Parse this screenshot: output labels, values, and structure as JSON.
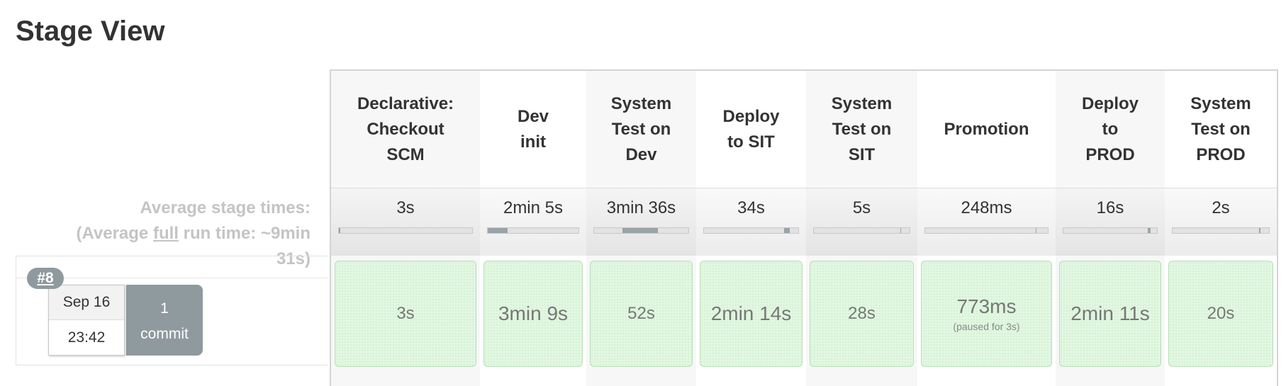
{
  "page": {
    "title": "Stage View"
  },
  "summary": {
    "avg_line1": "Average stage times:",
    "avg_line2_prefix": "(Average ",
    "avg_line2_link": "full",
    "avg_line2_suffix": " run time: ~9min",
    "avg_line3": "31s)"
  },
  "run": {
    "number": "#8",
    "date": "Sep 16",
    "time": "23:42",
    "commit_count": "1",
    "commit_label": "commit"
  },
  "stages": [
    {
      "name_lines": [
        "Declarative:",
        "Checkout",
        "SCM"
      ],
      "avg": "3s",
      "avg_fraction": 0.005,
      "duration": "3s",
      "note": ""
    },
    {
      "name_lines": [
        "Dev",
        "init"
      ],
      "avg": "2min 5s",
      "avg_fraction": 0.22,
      "duration": "3min 9s",
      "note": ""
    },
    {
      "name_lines": [
        "System",
        "Test on",
        "Dev"
      ],
      "avg": "3min 36s",
      "avg_fraction": 0.38,
      "duration": "52s",
      "note": ""
    },
    {
      "name_lines": [
        "Deploy",
        "to SIT"
      ],
      "avg": "34s",
      "avg_fraction": 0.06,
      "duration": "2min 14s",
      "note": ""
    },
    {
      "name_lines": [
        "System",
        "Test on",
        "SIT"
      ],
      "avg": "5s",
      "avg_fraction": 0.01,
      "duration": "28s",
      "note": ""
    },
    {
      "name_lines": [
        "Promotion"
      ],
      "avg": "248ms",
      "avg_fraction": 0.005,
      "duration": "773ms",
      "note": "(paused for 3s)"
    },
    {
      "name_lines": [
        "Deploy",
        "to",
        "PROD"
      ],
      "avg": "16s",
      "avg_fraction": 0.03,
      "duration": "2min 11s",
      "note": ""
    },
    {
      "name_lines": [
        "System",
        "Test on",
        "PROD"
      ],
      "avg": "2s",
      "avg_fraction": 0.005,
      "duration": "20s",
      "note": ""
    }
  ],
  "colors": {
    "success_cell": "#e2f7e2",
    "success_border": "#b7dfb7",
    "badge": "#8f9a9e"
  }
}
